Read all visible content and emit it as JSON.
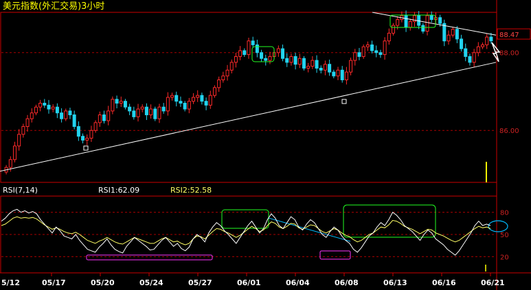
{
  "title": "美元指数(外汇交易)3小时",
  "colors": {
    "background": "#000000",
    "frame": "#cc0000",
    "up": "#ff2a2a",
    "down": "#22d3ee",
    "title": "#ffff00",
    "axis_text": "#ffffff",
    "rsi1": "#ffffff",
    "rsi2": "#ffff66",
    "trendline": "#ffffff",
    "box_green": "#22ff22",
    "box_magenta": "#ff33ff",
    "rsi_trend": "#00bbff"
  },
  "chart_data": [
    {
      "type": "candlestick",
      "title": "美元指数(外汇交易)3小时",
      "price_labels": [
        "88.47",
        "88.00",
        "86.00"
      ],
      "price_ticks": [
        88.47,
        88.0,
        86.0
      ],
      "ylim": [
        84.7,
        89.0
      ],
      "x_labels": [
        "5/12",
        "05/17",
        "05/20",
        "05/24",
        "05/27",
        "06/01",
        "06/04",
        "06/08",
        "06/13",
        "06/16",
        "06/21"
      ],
      "close_series": [
        85.05,
        85.25,
        85.6,
        85.9,
        86.1,
        86.3,
        86.45,
        86.6,
        86.7,
        86.65,
        86.55,
        86.6,
        86.45,
        86.3,
        86.5,
        86.4,
        86.1,
        85.85,
        85.75,
        85.8,
        86.0,
        86.2,
        86.4,
        86.25,
        86.5,
        86.8,
        86.7,
        86.75,
        86.6,
        86.5,
        86.35,
        86.55,
        86.6,
        86.4,
        86.55,
        86.3,
        86.6,
        86.5,
        86.85,
        86.9,
        86.75,
        86.7,
        86.55,
        86.75,
        86.85,
        86.9,
        86.75,
        86.65,
        86.9,
        87.1,
        87.3,
        87.4,
        87.55,
        87.75,
        87.9,
        88.05,
        87.95,
        88.3,
        88.2,
        88.0,
        87.85,
        87.8,
        87.9,
        88.0,
        88.1,
        87.85,
        87.75,
        87.9,
        87.7,
        87.85,
        87.6,
        87.65,
        87.8,
        87.6,
        87.55,
        87.7,
        87.5,
        87.4,
        87.55,
        87.3,
        87.5,
        87.8,
        88.0,
        87.9,
        88.15,
        88.2,
        88.05,
        88.0,
        87.95,
        88.3,
        88.5,
        88.7,
        88.85,
        88.95,
        88.65,
        88.8,
        88.95,
        88.7,
        88.55,
        88.95,
        88.85,
        88.9,
        88.75,
        88.3,
        88.45,
        88.6,
        88.35,
        88.1,
        87.9,
        87.75,
        88.0,
        88.15,
        88.2,
        88.4,
        88.3
      ],
      "annotations": {
        "support_line": {
          "from_date": "5/12",
          "from_price": 84.95,
          "to_date": "06/21",
          "to_price": 87.75
        },
        "resistance_line": {
          "from_date": "06/13",
          "from_price": 89.0,
          "to_date": "06/21",
          "to_price": 88.45
        },
        "green_boxes": [
          "06/01",
          "06/13"
        ]
      }
    },
    {
      "type": "line",
      "title": "RSI(7,14)",
      "series": [
        {
          "name": "RSI1",
          "label": "RSI1:62.09",
          "last": 62.09
        },
        {
          "name": "RSI2",
          "label": "RSI2:52.58",
          "last": 52.58
        }
      ],
      "y_labels": [
        "80",
        "50",
        "20"
      ],
      "y_ticks": [
        80,
        50,
        20
      ],
      "ylim": [
        0,
        100
      ],
      "rsi1_values": [
        68,
        72,
        78,
        82,
        84,
        80,
        82,
        79,
        81,
        78,
        70,
        64,
        58,
        52,
        60,
        55,
        48,
        46,
        44,
        50,
        42,
        36,
        30,
        28,
        26,
        33,
        38,
        44,
        36,
        30,
        27,
        25,
        34,
        40,
        46,
        42,
        38,
        34,
        29,
        30,
        36,
        42,
        46,
        40,
        34,
        38,
        31,
        28,
        33,
        44,
        50,
        46,
        40,
        52,
        60,
        66,
        62,
        55,
        50,
        44,
        38,
        46,
        54,
        62,
        68,
        60,
        52,
        58,
        70,
        78,
        72,
        62,
        58,
        66,
        74,
        70,
        60,
        56,
        64,
        70,
        66,
        58,
        50,
        46,
        54,
        60,
        56,
        48,
        42,
        38,
        30,
        26,
        32,
        40,
        48,
        52,
        60,
        66,
        62,
        70,
        80,
        76,
        70,
        62,
        58,
        54,
        48,
        42,
        50,
        56,
        52,
        44,
        40,
        36,
        30,
        26,
        22,
        28,
        36,
        44,
        52,
        62,
        68,
        62,
        64,
        62
      ],
      "rsi2_values": [
        62,
        64,
        68,
        72,
        74,
        72,
        73,
        72,
        73,
        71,
        67,
        63,
        60,
        57,
        59,
        57,
        54,
        52,
        51,
        53,
        50,
        46,
        42,
        40,
        38,
        41,
        43,
        46,
        43,
        40,
        38,
        37,
        40,
        43,
        46,
        44,
        42,
        40,
        38,
        38,
        41,
        44,
        46,
        43,
        40,
        41,
        38,
        36,
        38,
        44,
        48,
        47,
        44,
        49,
        54,
        58,
        57,
        54,
        52,
        49,
        46,
        49,
        53,
        57,
        61,
        58,
        54,
        56,
        62,
        67,
        65,
        60,
        58,
        61,
        65,
        64,
        59,
        57,
        60,
        63,
        62,
        58,
        54,
        52,
        55,
        58,
        56,
        52,
        49,
        47,
        43,
        40,
        42,
        46,
        50,
        52,
        56,
        60,
        59,
        63,
        69,
        68,
        65,
        61,
        59,
        57,
        54,
        51,
        54,
        57,
        56,
        52,
        50,
        48,
        45,
        42,
        40,
        42,
        46,
        50,
        54,
        58,
        61,
        59,
        60,
        58
      ],
      "annotations": {
        "green_boxes": [
          "06/01",
          "06/08-06/16"
        ],
        "magenta_boxes": [
          "05/17-05/27",
          "06/08"
        ]
      }
    }
  ]
}
